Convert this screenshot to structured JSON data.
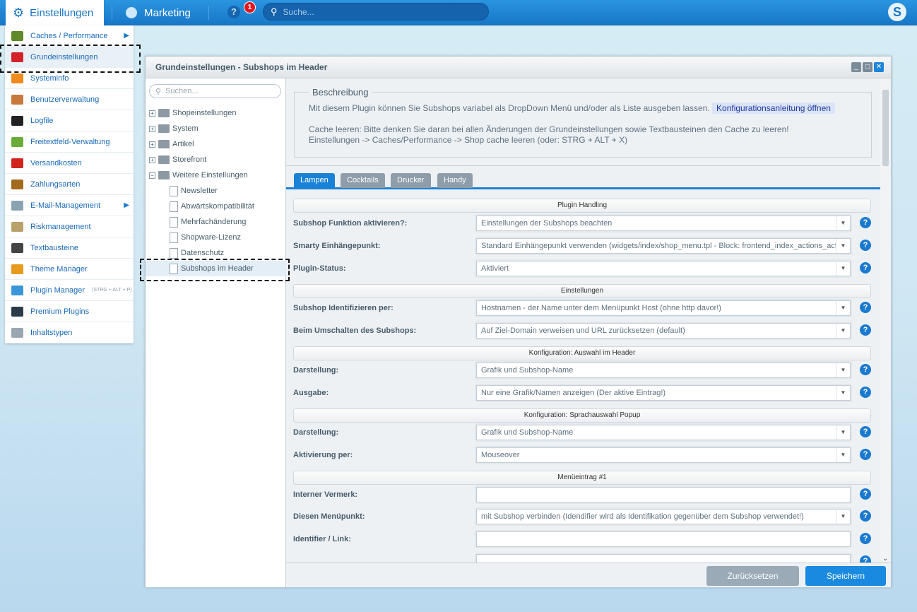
{
  "topbar": {
    "settings_label": "Einstellungen",
    "marketing_label": "Marketing",
    "help_badge": "1",
    "search_placeholder": "Suche...",
    "logo": "shopware-logo"
  },
  "menu": {
    "items": [
      {
        "label": "Caches / Performance",
        "icon": "gauge-icon",
        "color": "#5e8a2b",
        "submenu": true
      },
      {
        "label": "Grundeinstellungen",
        "icon": "wrench-icon",
        "color": "#d2232a",
        "selected": true
      },
      {
        "label": "Systeminfo",
        "icon": "bolt-icon",
        "color": "#f08a1c"
      },
      {
        "label": "Benutzerverwaltung",
        "icon": "user-icon",
        "color": "#c77a3c"
      },
      {
        "label": "Logfile",
        "icon": "terminal-icon",
        "color": "#222222"
      },
      {
        "label": "Freitextfeld-Verwaltung",
        "icon": "form-icon",
        "color": "#6bab3a"
      },
      {
        "label": "Versandkosten",
        "icon": "truck-icon",
        "color": "#d0231e"
      },
      {
        "label": "Zahlungsarten",
        "icon": "credit-card-icon",
        "color": "#a36a1d"
      },
      {
        "label": "E-Mail-Management",
        "icon": "mail-icon",
        "color": "#8aa3b3",
        "submenu": true
      },
      {
        "label": "Riskmanagement",
        "icon": "funnel-icon",
        "color": "#b8a26a"
      },
      {
        "label": "Textbausteine",
        "icon": "abc-icon",
        "color": "#444444"
      },
      {
        "label": "Theme Manager",
        "icon": "palette-icon",
        "color": "#e79a1e"
      },
      {
        "label": "Plugin Manager",
        "hint": "(STRG + ALT + P)",
        "icon": "puzzle-icon",
        "color": "#3a96d8"
      },
      {
        "label": "Premium Plugins",
        "icon": "shopware-icon",
        "color": "#2a3b4a"
      },
      {
        "label": "Inhaltstypen",
        "icon": "list-icon",
        "color": "#9aa6b0"
      }
    ]
  },
  "window": {
    "title": "Grundeinstellungen - Subshops im Header"
  },
  "tree": {
    "search_placeholder": "Suchen...",
    "nodes": [
      {
        "label": "Shopeinstellungen",
        "type": "folder",
        "expanded": false
      },
      {
        "label": "System",
        "type": "folder",
        "expanded": false
      },
      {
        "label": "Artikel",
        "type": "folder",
        "expanded": false
      },
      {
        "label": "Storefront",
        "type": "folder",
        "expanded": false
      },
      {
        "label": "Weitere Einstellungen",
        "type": "folder",
        "expanded": true
      },
      {
        "label": "Newsletter",
        "type": "leaf"
      },
      {
        "label": "Abwärtskompatibilität",
        "type": "leaf"
      },
      {
        "label": "Mehrfachänderung",
        "type": "leaf"
      },
      {
        "label": "Shopware-Lizenz",
        "type": "leaf"
      },
      {
        "label": "Datenschutz",
        "type": "leaf"
      },
      {
        "label": "Subshops im Header",
        "type": "leaf",
        "selected": true
      }
    ]
  },
  "description": {
    "legend": "Beschreibung",
    "line1": "Mit diesem Plugin können Sie Subshops variabel als DropDown Menü und/oder als Liste ausgeben lassen.",
    "link": "Konfigurationsanleitung öffnen",
    "line2": "Cache leeren: Bitte denken Sie daran bei allen Änderungen der Grundeinstellungen sowie Textbausteinen den Cache zu leeren!",
    "line3": "Einstellungen -> Caches/Performance -> Shop cache leeren (oder: STRG + ALT + X)"
  },
  "tabs": [
    "Lampen",
    "Cocktails",
    "Drucker",
    "Handy"
  ],
  "form": {
    "sections": [
      "Plugin Handling",
      "Einstellungen",
      "Konfiguration: Auswahl im Header",
      "Konfiguration: Sprachauswahl Popup",
      "Menüeintrag #1"
    ],
    "rows": [
      {
        "label": "Subshop Funktion aktivieren?:",
        "value": "Einstellungen der Subshops beachten",
        "dropdown": true
      },
      {
        "label": "Smarty Einhängepunkt:",
        "value": "Standard Einhängepunkt verwenden (widgets/index/shop_menu.tpl - Block: frontend_index_actions_active_shop)",
        "dropdown": true
      },
      {
        "label": "Plugin-Status:",
        "value": "Aktiviert",
        "dropdown": true
      },
      {
        "label": "Subshop Identifizieren per:",
        "value": "Hostnamen - der Name unter dem Menüpunkt Host (ohne http davor!)",
        "dropdown": true
      },
      {
        "label": "Beim Umschalten des Subshops:",
        "value": "Auf Ziel-Domain verweisen und URL zurücksetzen (default)",
        "dropdown": true
      },
      {
        "label": "Darstellung:",
        "value": "Grafik und Subshop-Name",
        "dropdown": true
      },
      {
        "label": "Ausgabe:",
        "value": "Nur eine Grafik/Namen anzeigen (Der aktive Eintrag!)",
        "dropdown": true
      },
      {
        "label": "Darstellung:",
        "value": "Grafik und Subshop-Name",
        "dropdown": true
      },
      {
        "label": "Aktivierung per:",
        "value": "Mouseover",
        "dropdown": true
      },
      {
        "label": "Interner Vermerk:",
        "value": "",
        "dropdown": false
      },
      {
        "label": "Diesen Menüpunkt:",
        "value": "mit Subshop verbinden (Idendifier wird als Identifikation gegenüber dem Subshop verwendet!)",
        "dropdown": true
      },
      {
        "label": "Identifier / Link:",
        "value": "",
        "dropdown": false
      }
    ]
  },
  "footer": {
    "reset_label": "Zurücksetzen",
    "save_label": "Speichern"
  },
  "colors": {
    "accent": "#1a82d6",
    "topbar": "#1e86d6"
  }
}
